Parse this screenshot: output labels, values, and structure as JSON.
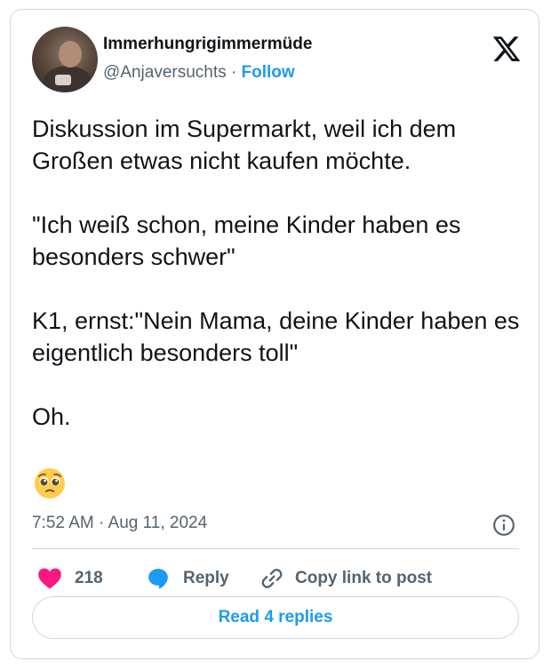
{
  "author": {
    "display_name": "Immerhungrigimmermüde",
    "handle": "@Anjaversuchts",
    "separator": " · ",
    "follow_label": "Follow"
  },
  "tweet": {
    "text": "Diskussion im Supermarkt, weil ich dem Großen etwas nicht kaufen möchte.\n\n\"Ich weiß schon, meine Kinder haben es besonders schwer\"\n\nK1, ernst:\"Nein Mama, deine Kinder haben es eigentlich besonders toll\"\n\nOh.",
    "emoji": "pleading-face",
    "timestamp": "7:52 AM · Aug 11, 2024"
  },
  "actions": {
    "like_count": "218",
    "reply_label": "Reply",
    "copy_label": "Copy link to post"
  },
  "read_replies_label": "Read 4 replies",
  "icons": {
    "logo": "x-logo-icon",
    "info": "info-icon",
    "like": "heart-icon",
    "reply": "speech-bubble-icon",
    "copy": "link-icon"
  },
  "colors": {
    "accent": "#1d9bf0",
    "like": "#f91880",
    "text": "#0f1419",
    "muted": "#536471",
    "border": "#cfd9de"
  }
}
